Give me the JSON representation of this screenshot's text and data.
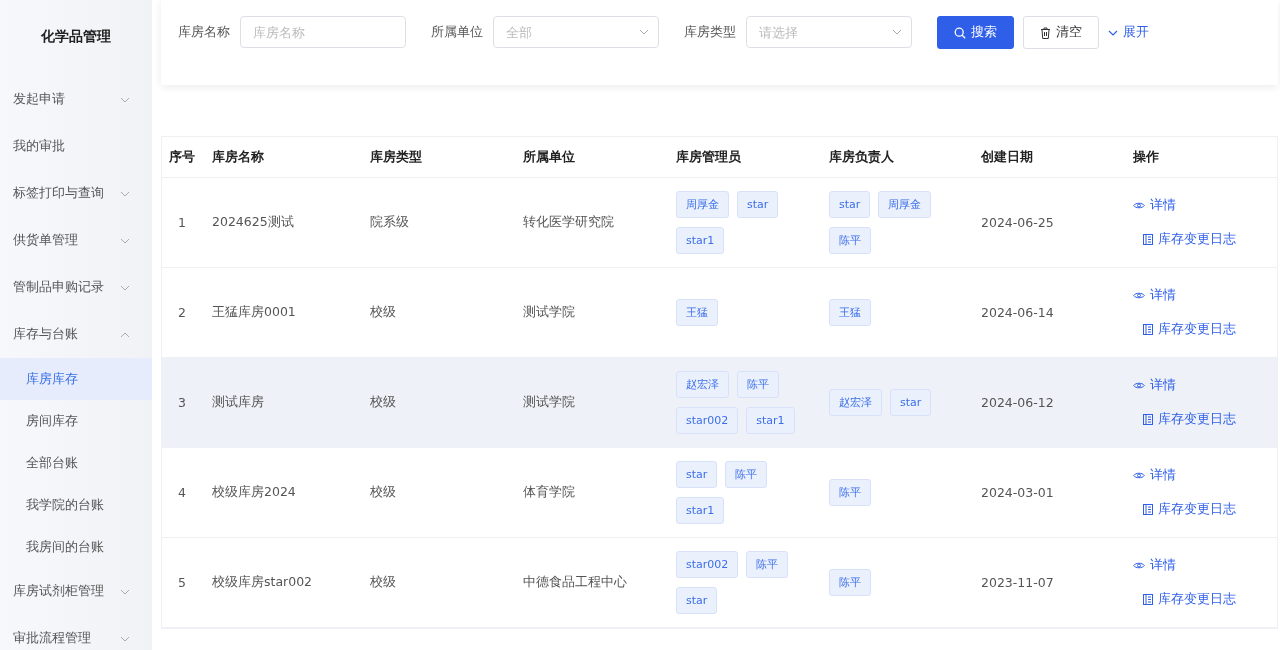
{
  "sidebar": {
    "title": "化学品管理",
    "items": [
      {
        "label": "发起申请",
        "expandable": true,
        "expanded": false,
        "selected": false
      },
      {
        "label": "我的审批",
        "expandable": false,
        "selected": false
      },
      {
        "label": "标签打印与查询",
        "expandable": true,
        "expanded": false,
        "selected": false
      },
      {
        "label": "供货单管理",
        "expandable": true,
        "expanded": false,
        "selected": false
      },
      {
        "label": "管制品申购记录",
        "expandable": true,
        "expanded": false,
        "selected": false
      },
      {
        "label": "库存与台账",
        "expandable": true,
        "expanded": true,
        "selected": false,
        "children": [
          {
            "label": "库房库存",
            "selected": true
          },
          {
            "label": "房间库存",
            "selected": false
          },
          {
            "label": "全部台账",
            "selected": false
          },
          {
            "label": "我学院的台账",
            "selected": false
          },
          {
            "label": "我房间的台账",
            "selected": false
          }
        ]
      },
      {
        "label": "库房试剂柜管理",
        "expandable": true,
        "expanded": false,
        "selected": false
      },
      {
        "label": "审批流程管理",
        "expandable": true,
        "expanded": false,
        "selected": false
      }
    ]
  },
  "filters": [
    {
      "label": "库房名称",
      "kind": "text",
      "placeholder": "库房名称"
    },
    {
      "label": "所属单位",
      "kind": "select",
      "placeholder": "全部"
    },
    {
      "label": "库房类型",
      "kind": "select",
      "placeholder": "请选择"
    }
  ],
  "buttons": {
    "search": "搜索",
    "clear": "清空",
    "expand": "展开"
  },
  "table": {
    "columns": [
      "序号",
      "库房名称",
      "库房类型",
      "所属单位",
      "库房管理员",
      "库房负责人",
      "创建日期",
      "操作"
    ],
    "rows": [
      {
        "index": "1",
        "name": "2024625测试",
        "type": "院系级",
        "unit": "转化医学研究院",
        "managers": [
          "周厚金",
          "star",
          "star1"
        ],
        "owners": [
          "star",
          "周厚金",
          "陈平"
        ],
        "date": "2024-06-25",
        "actions": [
          "详情",
          "库存变更日志"
        ],
        "highlighted": false
      },
      {
        "index": "2",
        "name": "王猛库房0001",
        "type": "校级",
        "unit": "测试学院",
        "managers": [
          "王猛"
        ],
        "owners": [
          "王猛"
        ],
        "date": "2024-06-14",
        "actions": [
          "详情",
          "库存变更日志"
        ],
        "highlighted": false
      },
      {
        "index": "3",
        "name": "测试库房",
        "type": "校级",
        "unit": "测试学院",
        "managers": [
          "赵宏泽",
          "陈平",
          "star002",
          "star1"
        ],
        "owners": [
          "赵宏泽",
          "star"
        ],
        "date": "2024-06-12",
        "actions": [
          "详情",
          "库存变更日志"
        ],
        "highlighted": true
      },
      {
        "index": "4",
        "name": "校级库房2024",
        "type": "校级",
        "unit": "体育学院",
        "managers": [
          "star",
          "陈平",
          "star1"
        ],
        "owners": [
          "陈平"
        ],
        "date": "2024-03-01",
        "actions": [
          "详情",
          "库存变更日志"
        ],
        "highlighted": false
      },
      {
        "index": "5",
        "name": "校级库房star002",
        "type": "校级",
        "unit": "中德食品工程中心",
        "managers": [
          "star002",
          "陈平",
          "star"
        ],
        "owners": [
          "陈平"
        ],
        "date": "2023-11-07",
        "actions": [
          "详情",
          "库存变更日志"
        ],
        "highlighted": false
      }
    ]
  }
}
